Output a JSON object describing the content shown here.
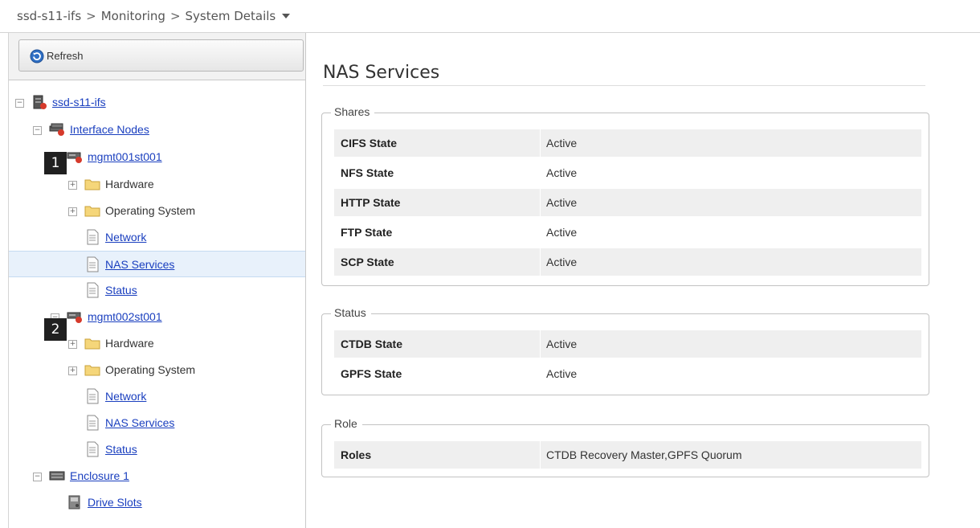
{
  "breadcrumb": [
    "ssd-s11-ifs",
    "Monitoring",
    "System Details"
  ],
  "toolbar": {
    "refresh_label": "Refresh"
  },
  "tree": [
    {
      "label": "ssd-s11-ifs",
      "link": true,
      "icon": "server-icon",
      "expander": "−"
    },
    {
      "label": "Interface Nodes",
      "link": true,
      "icon": "node-group-icon",
      "expander": "−"
    },
    {
      "label": "mgmt001st001",
      "link": true,
      "icon": "node-icon",
      "expander": "−",
      "badge": "1"
    },
    {
      "label": "Hardware",
      "link": false,
      "icon": "folder-icon",
      "expander": "+"
    },
    {
      "label": "Operating System",
      "link": false,
      "icon": "folder-icon",
      "expander": "+"
    },
    {
      "label": "Network",
      "link": true,
      "icon": "document-icon"
    },
    {
      "label": "NAS Services",
      "link": true,
      "icon": "document-icon",
      "selected": true
    },
    {
      "label": "Status",
      "link": true,
      "icon": "document-icon"
    },
    {
      "label": "mgmt002st001",
      "link": true,
      "icon": "node-icon",
      "expander": "−",
      "badge": "2"
    },
    {
      "label": "Hardware",
      "link": false,
      "icon": "folder-icon",
      "expander": "+"
    },
    {
      "label": "Operating System",
      "link": false,
      "icon": "folder-icon",
      "expander": "+"
    },
    {
      "label": "Network",
      "link": true,
      "icon": "document-icon"
    },
    {
      "label": "NAS Services",
      "link": true,
      "icon": "document-icon"
    },
    {
      "label": "Status",
      "link": true,
      "icon": "document-icon"
    },
    {
      "label": "Enclosure 1",
      "link": true,
      "icon": "enclosure-icon",
      "expander": "−"
    },
    {
      "label": "Drive Slots",
      "link": true,
      "icon": "drive-slots-icon"
    }
  ],
  "main": {
    "title": "NAS Services",
    "sections": [
      {
        "legend": "Shares",
        "rows": [
          {
            "key": "CIFS State",
            "value": "Active"
          },
          {
            "key": "NFS State",
            "value": "Active"
          },
          {
            "key": "HTTP State",
            "value": "Active"
          },
          {
            "key": "FTP State",
            "value": "Active"
          },
          {
            "key": "SCP State",
            "value": "Active"
          }
        ]
      },
      {
        "legend": "Status",
        "rows": [
          {
            "key": "CTDB State",
            "value": "Active"
          },
          {
            "key": "GPFS State",
            "value": "Active"
          }
        ]
      },
      {
        "legend": "Role",
        "rows": [
          {
            "key": "Roles",
            "value": "CTDB Recovery Master,GPFS Quorum"
          }
        ]
      }
    ]
  },
  "colors": {
    "link": "#1a3fbf",
    "selected_row": "#e8f1fb",
    "shaded_row": "#efefef"
  }
}
